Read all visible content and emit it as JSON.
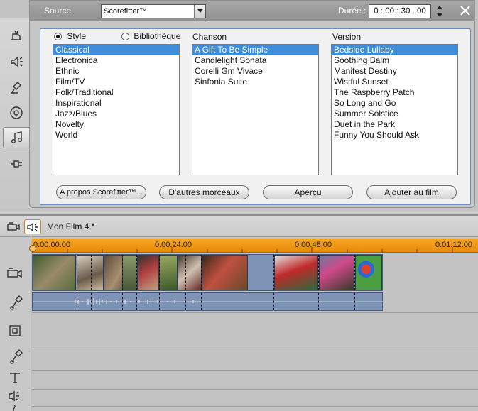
{
  "titlebar": {
    "source_label": "Source",
    "source_value": "Scorefitter™",
    "duration_label": "Durée :",
    "duration_value": "0 : 00 : 30 . 00"
  },
  "mode": {
    "style_label": "Style",
    "library_label": "Bibliothèque",
    "selected": "Style"
  },
  "columns": {
    "song_label": "Chanson",
    "version_label": "Version"
  },
  "styles": [
    "Classical",
    "Electronica",
    "Ethnic",
    "Film/TV",
    "Folk/Traditional",
    "Inspirational",
    "Jazz/Blues",
    "Novelty",
    "World"
  ],
  "songs": [
    "A Gift To Be Simple",
    "Candlelight Sonata",
    "Corelli Gm Vivace",
    "Sinfonia Suite"
  ],
  "versions": [
    "Bedside Lullaby",
    "Soothing Balm",
    "Manifest Destiny",
    "Wistful Sunset",
    "The Raspberry Patch",
    "So Long and Go",
    "Summer Solstice",
    "Duet in the Park",
    "Funny You Should Ask"
  ],
  "selected": {
    "style": "Classical",
    "song": "A Gift To Be Simple",
    "version": "Bedside Lullaby"
  },
  "buttons": {
    "about": "A propos Scorefitter™...",
    "more": "D'autres morceaux",
    "preview": "Aperçu",
    "add": "Ajouter au film"
  },
  "timeline": {
    "project_title": "Mon Film 4 *",
    "ticks": [
      "0:00:00.00",
      "0:00:24.00",
      "0:00:48.00",
      "0:01:12.00"
    ]
  },
  "colors": {
    "accent": "#3e8ddd",
    "ruler": "#f29a1a",
    "clip_bg": "#7d93b6"
  }
}
